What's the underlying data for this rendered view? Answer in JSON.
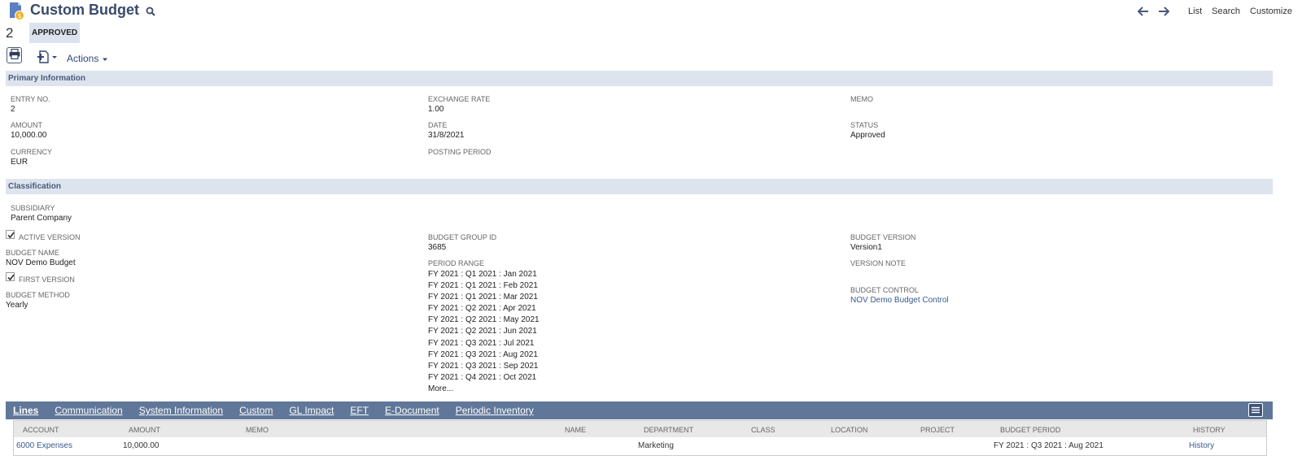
{
  "header": {
    "title": "Custom Budget",
    "entry_number": "2",
    "status_badge": "APPROVED"
  },
  "topnav": {
    "list": "List",
    "search": "Search",
    "customize": "Customize"
  },
  "toolbar": {
    "actions_label": "Actions"
  },
  "primary": {
    "section_title": "Primary Information",
    "entry_no_label": "ENTRY NO.",
    "entry_no_value": "2",
    "amount_label": "AMOUNT",
    "amount_value": "10,000.00",
    "currency_label": "CURRENCY",
    "currency_value": "EUR",
    "exchange_rate_label": "EXCHANGE RATE",
    "exchange_rate_value": "1.00",
    "date_label": "DATE",
    "date_value": "31/8/2021",
    "posting_period_label": "POSTING PERIOD",
    "memo_label": "MEMO",
    "status_label": "STATUS",
    "status_value": "Approved"
  },
  "classification": {
    "section_title": "Classification",
    "subsidiary_label": "SUBSIDIARY",
    "subsidiary_value": "Parent Company",
    "active_version_label": "ACTIVE VERSION",
    "active_version_checked": true,
    "budget_name_label": "BUDGET NAME",
    "budget_name_value": "NOV Demo Budget",
    "first_version_label": "FIRST VERSION",
    "first_version_checked": true,
    "budget_method_label": "BUDGET METHOD",
    "budget_method_value": "Yearly",
    "budget_group_id_label": "BUDGET GROUP ID",
    "budget_group_id_value": "3685",
    "period_range_label": "PERIOD RANGE",
    "period_range": [
      "FY 2021 : Q1 2021 : Jan 2021",
      "FY 2021 : Q1 2021 : Feb 2021",
      "FY 2021 : Q1 2021 : Mar 2021",
      "FY 2021 : Q2 2021 : Apr 2021",
      "FY 2021 : Q2 2021 : May 2021",
      "FY 2021 : Q2 2021 : Jun 2021",
      "FY 2021 : Q3 2021 : Jul 2021",
      "FY 2021 : Q3 2021 : Aug 2021",
      "FY 2021 : Q3 2021 : Sep 2021",
      "FY 2021 : Q4 2021 : Oct 2021"
    ],
    "more_label": "More...",
    "budget_version_label": "BUDGET VERSION",
    "budget_version_value": "Version1",
    "version_note_label": "VERSION NOTE",
    "budget_control_label": "BUDGET CONTROL",
    "budget_control_value": "NOV Demo Budget Control"
  },
  "tabs": [
    {
      "label": "Lines",
      "active": true
    },
    {
      "label": "Communication",
      "active": false
    },
    {
      "label": "System Information",
      "active": false
    },
    {
      "label": "Custom",
      "active": false
    },
    {
      "label": "GL Impact",
      "active": false
    },
    {
      "label": "EFT",
      "active": false
    },
    {
      "label": "E-Document",
      "active": false
    },
    {
      "label": "Periodic Inventory",
      "active": false
    }
  ],
  "lines": {
    "columns": [
      "ACCOUNT",
      "AMOUNT",
      "MEMO",
      "NAME",
      "DEPARTMENT",
      "CLASS",
      "LOCATION",
      "PROJECT",
      "BUDGET PERIOD",
      "HISTORY"
    ],
    "rows": [
      {
        "account": "6000 Expenses",
        "amount": "10,000.00",
        "memo": "",
        "name": "",
        "department": "Marketing",
        "class": "",
        "location": "",
        "project": "",
        "budget_period": "FY 2021 : Q3 2021 : Aug 2021",
        "history": "History"
      }
    ]
  },
  "colors": {
    "accent": "#607799",
    "section_bg": "#dde4ee",
    "link": "#3a5a8c",
    "title": "#3a4a6b"
  },
  "icons": {
    "record": "budget-record-icon",
    "search": "search-icon",
    "back": "back-arrow-icon",
    "forward": "forward-arrow-icon",
    "print": "printer-icon",
    "new": "new-record-icon",
    "check": "check-icon",
    "menu": "list-menu-icon"
  }
}
